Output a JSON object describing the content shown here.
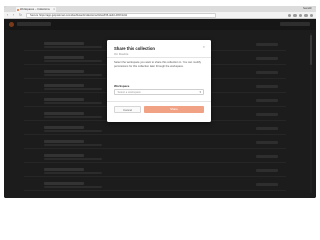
{
  "browser": {
    "tab_label": "Workspaces – Collections",
    "tab_close": "×",
    "window_user": "Saurabh",
    "url": "Secure  https://app.getpostman.com/dashboard/collections/2cbe2f35-de40-4b5f-9d11",
    "nav": {
      "back": "‹",
      "forward": "›",
      "reload": "↻"
    }
  },
  "modal": {
    "title": "Share this collection",
    "subtitle": "On Doubts",
    "close": "×",
    "description": "Select the workspace you want to share this collection in. You can modify permissions for this collection later through the workspace.",
    "workspace_label": "Workspace",
    "workspace_placeholder": "Select a workspace",
    "select_caret": "▾",
    "cancel_label": "Cancel",
    "share_label": "Share"
  },
  "colors": {
    "share_button": "#f1a285",
    "overlay_background": "#1c1c1c"
  }
}
